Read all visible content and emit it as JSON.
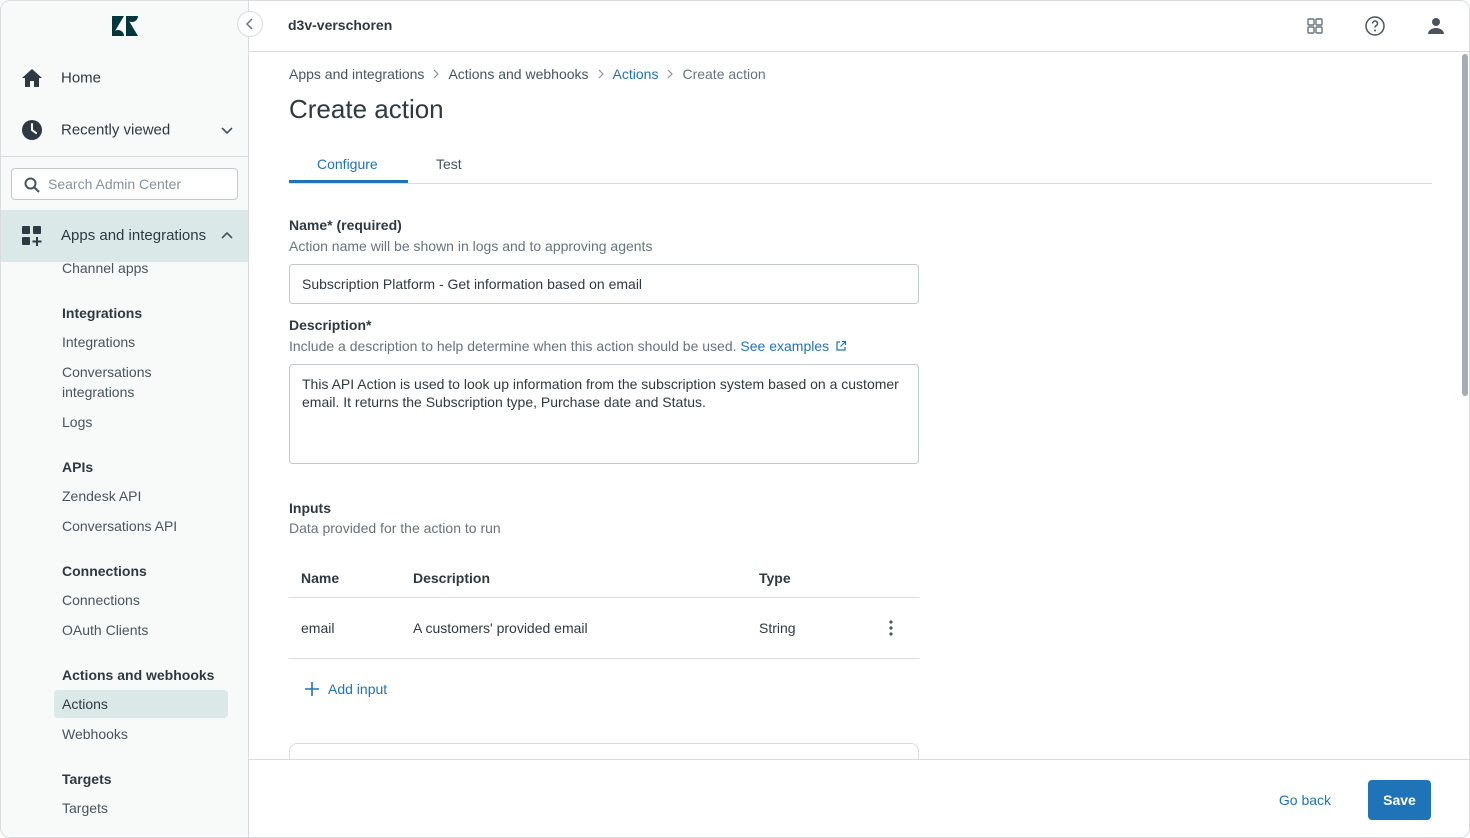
{
  "header": {
    "account": "d3v-verschoren"
  },
  "sidebar": {
    "home_label": "Home",
    "recent_label": "Recently viewed",
    "search_placeholder": "Search Admin Center",
    "section_label": "Apps and integrations",
    "items": {
      "channel_apps": "Channel apps",
      "integrations_group": "Integrations",
      "integrations": "Integrations",
      "conversations_integrations_l1": "Conversations",
      "conversations_integrations_l2": "integrations",
      "logs": "Logs",
      "apis_group": "APIs",
      "zendesk_api": "Zendesk API",
      "conversations_api": "Conversations API",
      "connections_group": "Connections",
      "connections": "Connections",
      "oauth_clients": "OAuth Clients",
      "actions_webhooks_group": "Actions and webhooks",
      "actions": "Actions",
      "webhooks": "Webhooks",
      "targets_group": "Targets",
      "targets": "Targets"
    }
  },
  "breadcrumb": [
    "Apps and integrations",
    "Actions and webhooks",
    "Actions",
    "Create action"
  ],
  "page_title": "Create action",
  "tabs": [
    "Configure",
    "Test"
  ],
  "form": {
    "name_label": "Name* (required)",
    "name_hint": "Action name will be shown in logs and to approving agents",
    "name_value": "Subscription Platform - Get information based on email",
    "desc_label": "Description*",
    "desc_hint": "Include a description to help determine when this action should be used.",
    "desc_link": "See examples",
    "desc_value": "This API Action is used to look up information from the subscription system based on a customer email. It returns the Subscription type, Purchase date and Status."
  },
  "inputs": {
    "title": "Inputs",
    "hint": "Data provided for the action to run",
    "columns": [
      "Name",
      "Description",
      "Type"
    ],
    "rows": [
      {
        "name": "email",
        "description": "A customers' provided email",
        "type": "String"
      }
    ],
    "add_label": "Add input"
  },
  "footer": {
    "back_label": "Go back",
    "save_label": "Save"
  },
  "colors": {
    "accent": "#1f73b7",
    "active_bg": "#dbe8e8",
    "logo": "#03363d"
  }
}
